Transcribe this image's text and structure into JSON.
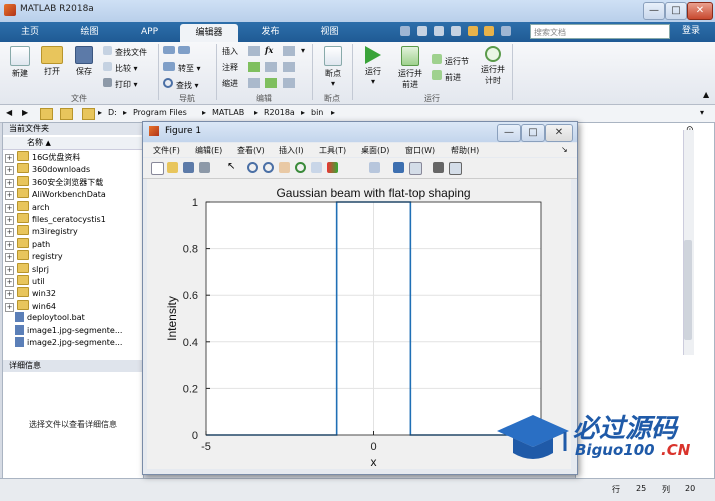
{
  "window": {
    "title": "MATLAB R2018a",
    "min": "—",
    "max": "□",
    "close": "✕"
  },
  "tabs": [
    "主页",
    "绘图",
    "APP",
    "编辑器",
    "发布",
    "视图"
  ],
  "active_tab": "编辑器",
  "search": {
    "placeholder": "搜索文档"
  },
  "login": "登录",
  "ribbon": {
    "file": {
      "new": "新建",
      "open": "打开",
      "save": "保存",
      "find_files": "查找文件",
      "compare": "比较",
      "print": "打印",
      "label": "文件"
    },
    "nav": {
      "goto": "转至",
      "find": "查找",
      "label": "导航"
    },
    "edit": {
      "insert": "插入",
      "comment": "注释",
      "indent": "缩进",
      "fx": "fx",
      "label": "编辑"
    },
    "breakpoints": {
      "btn": "断点",
      "label": "断点"
    },
    "run": {
      "run": "运行",
      "run_advance_1": "运行并",
      "run_advance_2": "前进",
      "run_section": "运行节",
      "advance": "前进",
      "run_time_1": "运行并",
      "run_time_2": "计时",
      "label": "运行"
    }
  },
  "address": [
    "D:",
    "Program Files",
    "MATLAB",
    "R2018a",
    "bin"
  ],
  "current_folder": {
    "title": "当前文件夹",
    "col_name": "名称",
    "items": [
      {
        "name": "16G优盘资料",
        "type": "folder"
      },
      {
        "name": "360downloads",
        "type": "folder"
      },
      {
        "name": "360安全浏览器下载",
        "type": "folder"
      },
      {
        "name": "AliWorkbenchData",
        "type": "folder"
      },
      {
        "name": "arch",
        "type": "folder"
      },
      {
        "name": "files_ceratocystis1",
        "type": "folder"
      },
      {
        "name": "m3iregistry",
        "type": "folder"
      },
      {
        "name": "path",
        "type": "folder"
      },
      {
        "name": "registry",
        "type": "folder"
      },
      {
        "name": "slprj",
        "type": "folder"
      },
      {
        "name": "util",
        "type": "folder"
      },
      {
        "name": "win32",
        "type": "folder"
      },
      {
        "name": "win64",
        "type": "folder"
      },
      {
        "name": "deploytool.bat",
        "type": "file"
      },
      {
        "name": "image1.jpg-segmente...",
        "type": "file"
      },
      {
        "name": "image2.jpg-segmente...",
        "type": "file"
      }
    ]
  },
  "details": {
    "title": "详细信息",
    "hint": "选择文件以查看详细信息"
  },
  "status": {
    "row_label": "行",
    "row": "25",
    "col_label": "列",
    "col": "20"
  },
  "figure": {
    "title": "Figure 1",
    "menu": [
      "文件(F)",
      "编辑(E)",
      "查看(V)",
      "插入(I)",
      "工具(T)",
      "桌面(D)",
      "窗口(W)",
      "帮助(H)"
    ]
  },
  "chart_data": {
    "type": "line",
    "title": "Gaussian beam with flat-top shaping",
    "xlabel": "x",
    "ylabel": "Intensity",
    "xlim": [
      -5,
      5
    ],
    "ylim": [
      0,
      1
    ],
    "xticks": [
      -5,
      0,
      5
    ],
    "xticklabels": [
      "-5",
      "0",
      ""
    ],
    "yticks": [
      0,
      0.2,
      0.4,
      0.6,
      0.8,
      1
    ],
    "yticklabels": [
      "0",
      "0.2",
      "0.4",
      "0.6",
      "0.8",
      "1"
    ],
    "grid": true,
    "line_color": "#1f6fb5",
    "series": [
      {
        "x": [
          -5,
          -1.1,
          -1.1,
          1.1,
          1.1,
          5
        ],
        "y": [
          0,
          0,
          1,
          1,
          0,
          0
        ]
      }
    ]
  },
  "watermark": {
    "text_cn": "必过源码",
    "text_en": "Biguo100",
    "suffix": ".CN"
  }
}
